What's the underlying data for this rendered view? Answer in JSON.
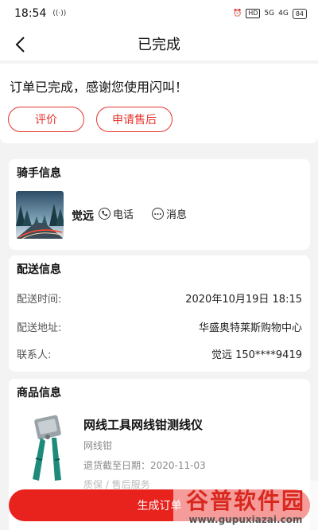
{
  "status_bar": {
    "time": "18:54",
    "right": [
      "HD",
      "5G",
      "4G",
      "84"
    ]
  },
  "nav": {
    "title": "已完成"
  },
  "order_done": {
    "message": "订单已完成，感谢您使用闪叫！",
    "rate_label": "评价",
    "after_sale_label": "申请售后"
  },
  "rider": {
    "section_title": "骑手信息",
    "name": "觉远",
    "call_label": "电话",
    "message_label": "消息"
  },
  "delivery": {
    "section_title": "配送信息",
    "rows": [
      {
        "label": "配送时间:",
        "value": "2020年10月19日 18:15"
      },
      {
        "label": "配送地址:",
        "value": "华盛奥特莱斯购物中心"
      },
      {
        "label": "联系人:",
        "value": "觉远 150****9419"
      }
    ]
  },
  "goods": {
    "section_title": "商品信息",
    "name": "网线工具网线钳测线仪",
    "subtitle": "网线钳",
    "return_deadline": "退货截至日期：2020-11-03",
    "more": "质保 / 售后服务"
  },
  "bottom": {
    "generate_label": "生成订单"
  },
  "watermark": {
    "text": "谷普软件园",
    "url": "www.gupuxiazai.com"
  },
  "colors": {
    "accent": "#e5332e",
    "button": "#e8231e"
  }
}
